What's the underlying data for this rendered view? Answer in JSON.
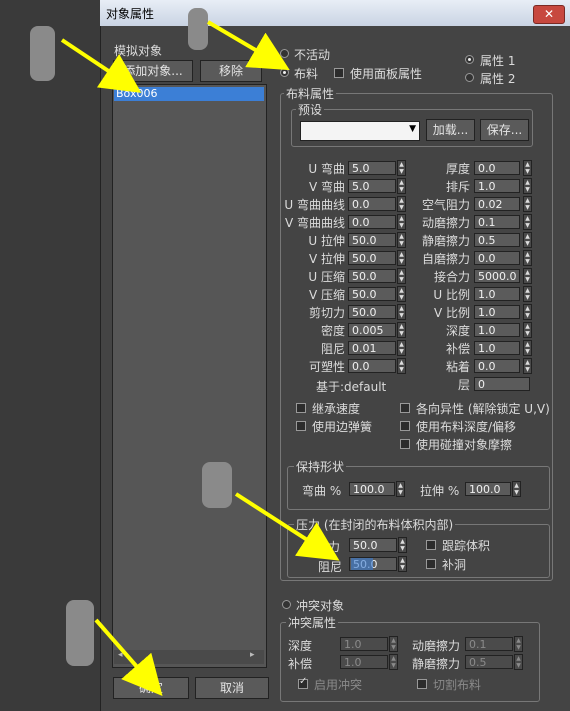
{
  "window": {
    "title": "对象属性",
    "close_label": "✕"
  },
  "sim_objects": {
    "label": "模拟对象",
    "add_button": "添加对象...",
    "remove_button": "移除",
    "items": [
      "Box006"
    ]
  },
  "mode": {
    "inactive": "不活动",
    "cloth": "布料",
    "use_panel_props": "使用面板属性",
    "prop1": "属性 1",
    "prop2": "属性 2"
  },
  "cloth_props": {
    "group_title": "布料属性",
    "preset_title": "预设",
    "load_button": "加载...",
    "save_button": "保存...",
    "left_fields": [
      {
        "label": "U 弯曲",
        "value": "5.0"
      },
      {
        "label": "V 弯曲",
        "value": "5.0"
      },
      {
        "label": "U 弯曲曲线",
        "value": "0.0"
      },
      {
        "label": "V 弯曲曲线",
        "value": "0.0"
      },
      {
        "label": "U 拉伸",
        "value": "50.0"
      },
      {
        "label": "V 拉伸",
        "value": "50.0"
      },
      {
        "label": "U 压缩",
        "value": "50.0"
      },
      {
        "label": "V 压缩",
        "value": "50.0"
      },
      {
        "label": "剪切力",
        "value": "50.0"
      },
      {
        "label": "密度",
        "value": "0.005"
      },
      {
        "label": "阻尼",
        "value": "0.01"
      },
      {
        "label": "可塑性",
        "value": "0.0"
      }
    ],
    "right_fields": [
      {
        "label": "厚度",
        "value": "0.0"
      },
      {
        "label": "排斥",
        "value": "1.0"
      },
      {
        "label": "空气阻力",
        "value": "0.02"
      },
      {
        "label": "动磨擦力",
        "value": "0.1"
      },
      {
        "label": "静磨擦力",
        "value": "0.5"
      },
      {
        "label": "自磨擦力",
        "value": "0.0"
      },
      {
        "label": "接合力",
        "value": "5000.0"
      },
      {
        "label": "U 比例",
        "value": "1.0"
      },
      {
        "label": "V 比例",
        "value": "1.0"
      },
      {
        "label": "深度",
        "value": "1.0"
      },
      {
        "label": "补偿",
        "value": "1.0"
      },
      {
        "label": "粘着",
        "value": "0.0"
      },
      {
        "label": "层",
        "value": "0"
      }
    ],
    "based_on": "基于:default",
    "checkboxes": {
      "inherit_velocity": "继承速度",
      "use_edge_springs": "使用边弹簧",
      "anisotropic": "各向异性 (解除锁定 U,V)",
      "use_cloth_depth": "使用布料深度/偏移",
      "use_collision_friction": "使用碰撞对象摩擦"
    }
  },
  "keep_shape": {
    "title": "保持形状",
    "bend_label": "弯曲 %",
    "bend_value": "100.0",
    "stretch_label": "拉伸 %",
    "stretch_value": "100.0"
  },
  "pressure": {
    "title": "压力 (在封闭的布料体积内部)",
    "pressure_label": "压力",
    "pressure_value": "50.0",
    "damping_label": "阻尼",
    "damping_value": "50.0",
    "track_volume": "跟踪体积",
    "cap_holes": "补洞"
  },
  "collision": {
    "radio_label": "冲突对象",
    "group_title": "冲突属性",
    "depth_label": "深度",
    "depth_value": "1.0",
    "offset_label": "补偿",
    "offset_value": "1.0",
    "dyn_friction_label": "动磨擦力",
    "dyn_friction_value": "0.1",
    "static_friction_label": "静磨擦力",
    "static_friction_value": "0.5",
    "enable_collision": "启用冲突",
    "cut_cloth": "切割布料"
  },
  "footer": {
    "ok": "确定",
    "cancel": "取消"
  },
  "colors": {
    "arrow": "#ffff00",
    "selection": "#3c7fd6"
  }
}
